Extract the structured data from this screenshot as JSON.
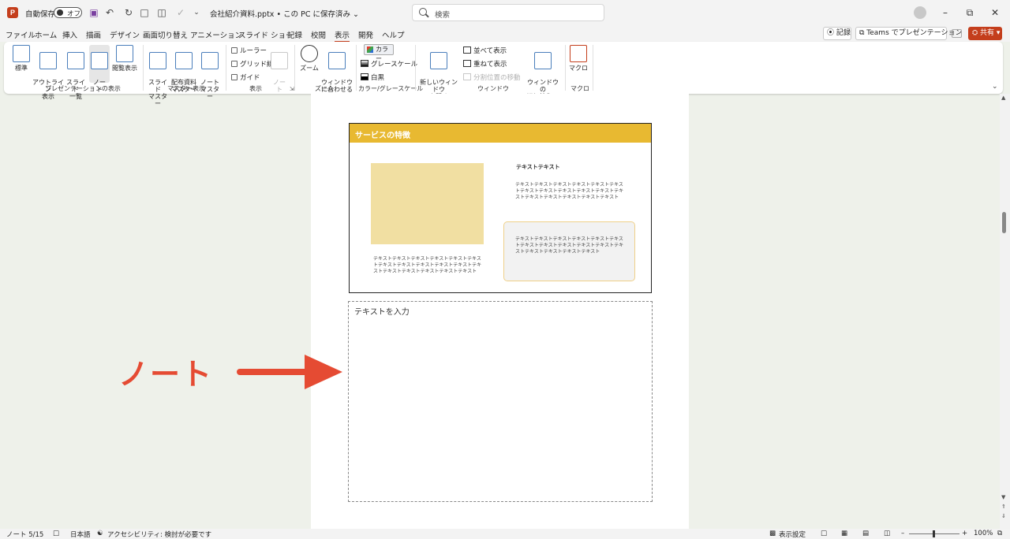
{
  "titlebar": {
    "app_logo": "P",
    "autosave_label": "自動保存",
    "autosave_toggle": "オフ",
    "document_title": "会社紹介資料.pptx • この PC に保存済み ⌄",
    "search_placeholder": "検索",
    "quick_access_icons": [
      "save-icon",
      "undo-icon",
      "redo-icon",
      "presenter-icon",
      "layout-icon",
      "spelling-icon",
      "more-icon"
    ]
  },
  "tabs": [
    "ファイル",
    "ホーム",
    "挿入",
    "描画",
    "デザイン",
    "画面切り替え",
    "アニメーション",
    "スライド ショー",
    "記録",
    "校閲",
    "表示",
    "開発",
    "ヘルプ"
  ],
  "active_tab": "表示",
  "header_actions": {
    "record": "⦿ 記録",
    "teams": "⧉ Teams でプレゼンテーション",
    "share": "⛭ 共有 ▾"
  },
  "ribbon": {
    "presentation_views": {
      "label": "プレゼンテーションの表示",
      "normal": "標準",
      "outline": "アウトライン\n表示",
      "sorter": "スライド\n一覧",
      "notes": "ノー\nト",
      "reading": "閲覧表示"
    },
    "master_views": {
      "label": "マスター表示",
      "slide_master": "スライド\nマスター",
      "handout_master": "配布資料\nマスター",
      "notes_master": "ノート\nマスター"
    },
    "show": {
      "label": "表示",
      "ruler": "ルーラー",
      "gridlines": "グリッド線",
      "guides": "ガイド",
      "notes": "ノー\nト"
    },
    "zoom": {
      "label": "ズーム",
      "zoom": "ズーム",
      "fit": "ウィンドウ\nに合わせる"
    },
    "color": {
      "label": "カラー/グレースケール",
      "color": "カラー",
      "grayscale": "グレースケール",
      "bw": "白黒"
    },
    "window": {
      "label": "ウィンドウ",
      "new_window": "新しいウィンドウ\nを開く",
      "arrange_all": "並べて表示",
      "cascade": "重ねて表示",
      "move_split": "分割位置の移動",
      "switch_windows": "ウィンドウの\n切り替え ⌄"
    },
    "macros": {
      "label": "マクロ",
      "macros": "マクロ"
    }
  },
  "slide": {
    "title": "サービスの特徴",
    "heading": "テキストテキスト",
    "body_right": "テキストテキストテキストテキストテキストテキストテキストテキストテキストテキストテキストテキストテキストテキストテキストテキストテキスト",
    "body_box": "テキストテキストテキストテキストテキストテキストテキストテキストテキストテキストテキストテキストテキストテキストテキストテキスト",
    "body_left": "テキストテキストテキストテキストテキストテキストテキストテキストテキストテキストテキストテキストテキストテキストテキストテキストテキスト"
  },
  "notes": {
    "placeholder": "テキストを入力"
  },
  "annotation": {
    "label": "ノート"
  },
  "statusbar": {
    "slide_info": "ノート 5/15",
    "language": "日本語",
    "accessibility": "アクセシビリティ: 検討が必要です",
    "display_settings": "表示設定",
    "zoom": "100%"
  },
  "colors": {
    "accent": "#c43e1c",
    "slide_header": "#e8b931",
    "annotation": "#e54b33"
  }
}
